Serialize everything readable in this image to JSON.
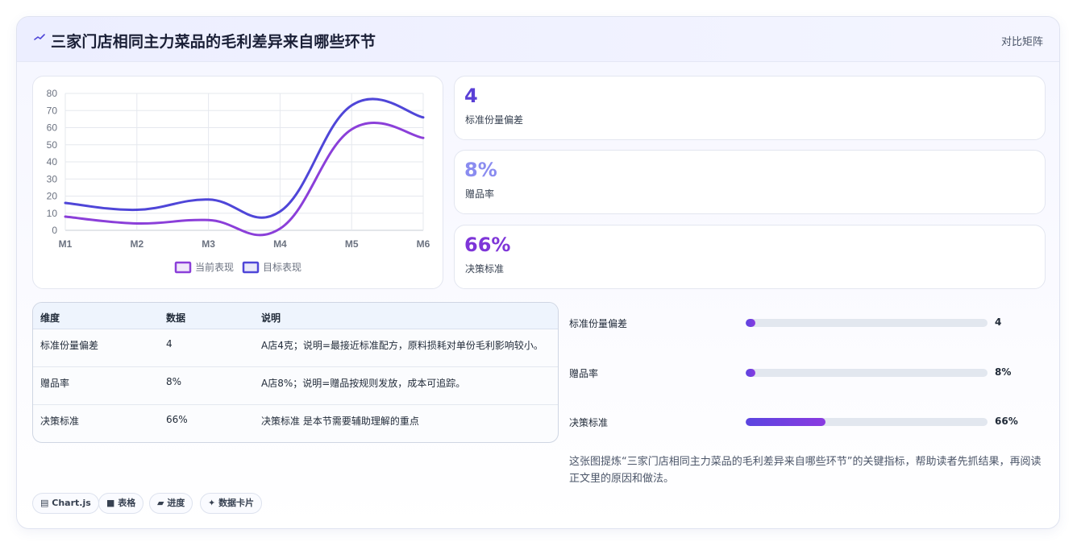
{
  "header": {
    "title": "三家门店相同主力菜品的毛利差异来自哪些环节",
    "link": "对比矩阵",
    "icon": "trend-icon"
  },
  "chart_data": {
    "type": "line",
    "categories": [
      "M1",
      "M2",
      "M3",
      "M4",
      "M5",
      "M6"
    ],
    "ylim": [
      0,
      80
    ],
    "yticks": [
      0,
      10,
      20,
      30,
      40,
      50,
      60,
      70,
      80
    ],
    "grid": true,
    "legend": "bottom",
    "series": [
      {
        "name": "当前表现",
        "values": [
          8,
          4,
          6,
          1,
          59,
          54
        ],
        "color": "#8b3fd9"
      },
      {
        "name": "目标表现",
        "values": [
          16,
          12,
          18,
          11,
          73,
          66
        ],
        "color": "#4f46d8"
      }
    ]
  },
  "stats": [
    {
      "value": "4",
      "label": "标准份量偏差",
      "color": "#5a3fd6"
    },
    {
      "value": "8%",
      "label": "赠品率",
      "color": "#8a8cf0"
    },
    {
      "value": "66%",
      "label": "决策标准",
      "color": "#7e35d8"
    }
  ],
  "table": {
    "headers": [
      "维度",
      "数据",
      "说明"
    ],
    "rows": [
      [
        "标准份量偏差",
        "4",
        "A店4克；说明=最接近标准配方，原料损耗对单份毛利影响较小。"
      ],
      [
        "赠品率",
        "8%",
        "A店8%；说明=赠品按规则发放，成本可追踪。"
      ],
      [
        "决策标准",
        "66%",
        "决策标准 是本节需要辅助理解的重点"
      ]
    ]
  },
  "progress": [
    {
      "label": "标准份量偏差",
      "value": "4",
      "fraction": 0.04
    },
    {
      "label": "赠品率",
      "value": "8%",
      "fraction": 0.04
    },
    {
      "label": "决策标准",
      "value": "66%",
      "fraction": 0.33
    }
  ],
  "description": "这张图提炼“三家门店相同主力菜品的毛利差异来自哪些环节”的关键指标，帮助读者先抓结果，再阅读正文里的原因和做法。",
  "tags": [
    {
      "icon": "chart-icon",
      "label": "Chart.js",
      "glyph": "▤"
    },
    {
      "icon": "table-icon",
      "label": "表格",
      "glyph": "■"
    },
    {
      "icon": "progress-icon",
      "label": "进度",
      "glyph": "▰"
    },
    {
      "icon": "sparkle-icon",
      "label": "数据卡片",
      "glyph": "✦"
    }
  ]
}
